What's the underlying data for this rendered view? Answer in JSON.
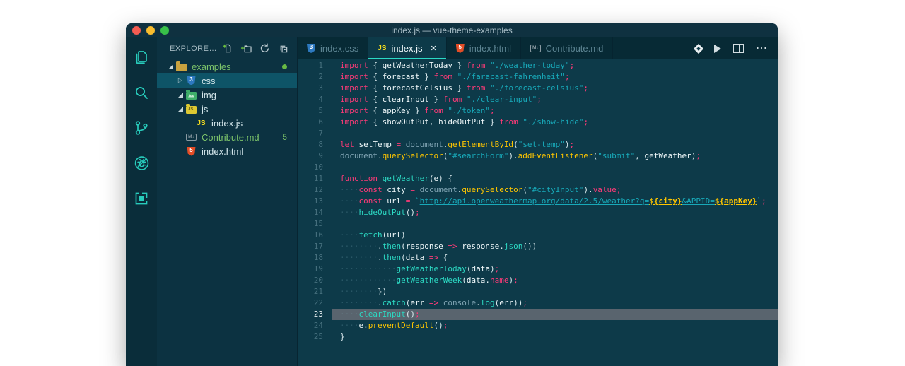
{
  "window": {
    "title": "index.js — vue-theme-examples"
  },
  "colors": {
    "accent_teal": "#2bd9c5",
    "keyword_pink": "#ff3a78",
    "method_yellow": "#ffc600",
    "string_teal": "#18a9b9",
    "green_modified": "#7cc36a",
    "editor_bg": "#0d3a49",
    "sidebar_bg": "#0c3241",
    "activitybar_bg": "#0a2d3a",
    "tabbar_bg": "#072a35",
    "selected_row": "#0e5467",
    "line_highlight": "#59646e",
    "traffic_red": "#f45c52",
    "traffic_yellow": "#f9bd2e",
    "traffic_green": "#38c149"
  },
  "activity_bar": {
    "items": [
      {
        "name": "explorer",
        "icon": "files-icon"
      },
      {
        "name": "search",
        "icon": "search-icon"
      },
      {
        "name": "source-control",
        "icon": "git-branch-icon"
      },
      {
        "name": "debug",
        "icon": "debug-disabled-icon"
      },
      {
        "name": "extensions",
        "icon": "extensions-icon"
      }
    ]
  },
  "sidebar": {
    "header": {
      "title": "EXPLORE…",
      "actions": [
        "new-file",
        "new-folder",
        "refresh",
        "collapse-all"
      ]
    },
    "tree": [
      {
        "label": "examples",
        "indent": 0,
        "twisty": "expanded",
        "icon": "folder-examples",
        "green": true,
        "dot": true
      },
      {
        "label": "css",
        "indent": 1,
        "twisty": "collapsed",
        "icon": "folder-css",
        "selected": true
      },
      {
        "label": "img",
        "indent": 1,
        "twisty": "expanded",
        "icon": "folder-img"
      },
      {
        "label": "js",
        "indent": 1,
        "twisty": "expanded",
        "icon": "folder-js"
      },
      {
        "label": "index.js",
        "indent": 2,
        "twisty": "none",
        "icon": "file-js"
      },
      {
        "label": "Contribute.md",
        "indent": 1,
        "twisty": "none",
        "icon": "file-md",
        "green": true,
        "badge": "5"
      },
      {
        "label": "index.html",
        "indent": 1,
        "twisty": "none",
        "icon": "file-html"
      }
    ]
  },
  "editor": {
    "tabs": [
      {
        "label": "index.css",
        "icon": "css",
        "active": false
      },
      {
        "label": "index.js",
        "icon": "js",
        "active": true,
        "close_glyph": "✕"
      },
      {
        "label": "index.html",
        "icon": "html",
        "active": false
      },
      {
        "label": "Contribute.md",
        "icon": "md",
        "active": false
      }
    ],
    "actions": [
      {
        "name": "formatter-diamond-icon"
      },
      {
        "name": "run-icon"
      },
      {
        "name": "split-editor-icon"
      },
      {
        "name": "more-actions-icon",
        "glyph": "⋯"
      }
    ],
    "active_line": 23,
    "lines": [
      {
        "n": 1,
        "tokens": [
          [
            "kw",
            "import"
          ],
          [
            "pl",
            " { "
          ],
          [
            "id",
            "getWeatherToday"
          ],
          [
            "pl",
            " } "
          ],
          [
            "kw",
            "from"
          ],
          [
            "pl",
            " "
          ],
          [
            "st",
            "\"./weather-today\""
          ],
          [
            "kw",
            ";"
          ]
        ]
      },
      {
        "n": 2,
        "tokens": [
          [
            "kw",
            "import"
          ],
          [
            "pl",
            " { "
          ],
          [
            "id",
            "forecast"
          ],
          [
            "pl",
            " } "
          ],
          [
            "kw",
            "from"
          ],
          [
            "pl",
            " "
          ],
          [
            "st",
            "\"./faracast-fahrenheit\""
          ],
          [
            "kw",
            ";"
          ]
        ]
      },
      {
        "n": 3,
        "tokens": [
          [
            "kw",
            "import"
          ],
          [
            "pl",
            " { "
          ],
          [
            "id",
            "forecastCelsius"
          ],
          [
            "pl",
            " } "
          ],
          [
            "kw",
            "from"
          ],
          [
            "pl",
            " "
          ],
          [
            "st",
            "\"./forecast-celsius\""
          ],
          [
            "kw",
            ";"
          ]
        ]
      },
      {
        "n": 4,
        "tokens": [
          [
            "kw",
            "import"
          ],
          [
            "pl",
            " { "
          ],
          [
            "id",
            "clearInput"
          ],
          [
            "pl",
            " } "
          ],
          [
            "kw",
            "from"
          ],
          [
            "pl",
            " "
          ],
          [
            "st",
            "\"./clear-input\""
          ],
          [
            "kw",
            ";"
          ]
        ]
      },
      {
        "n": 5,
        "tokens": [
          [
            "kw",
            "import"
          ],
          [
            "pl",
            " { "
          ],
          [
            "id",
            "appKey"
          ],
          [
            "pl",
            " } "
          ],
          [
            "kw",
            "from"
          ],
          [
            "pl",
            " "
          ],
          [
            "st",
            "\"./token\""
          ],
          [
            "kw",
            ";"
          ]
        ]
      },
      {
        "n": 6,
        "tokens": [
          [
            "kw",
            "import"
          ],
          [
            "pl",
            " { "
          ],
          [
            "id",
            "showOutPut"
          ],
          [
            "pl",
            ", "
          ],
          [
            "id",
            "hideOutPut"
          ],
          [
            "pl",
            " } "
          ],
          [
            "kw",
            "from"
          ],
          [
            "pl",
            " "
          ],
          [
            "st",
            "\"./show-hide\""
          ],
          [
            "kw",
            ";"
          ]
        ]
      },
      {
        "n": 7,
        "tokens": []
      },
      {
        "n": 8,
        "tokens": [
          [
            "kw",
            "let"
          ],
          [
            "pl",
            " "
          ],
          [
            "id",
            "setTemp"
          ],
          [
            "pl",
            " "
          ],
          [
            "kw",
            "="
          ],
          [
            "pl",
            " "
          ],
          [
            "ob",
            "document"
          ],
          [
            "pl",
            "."
          ],
          [
            "yf",
            "getElementById"
          ],
          [
            "pl",
            "("
          ],
          [
            "st",
            "\"set-temp\""
          ],
          [
            "pl",
            ")"
          ],
          [
            "kw",
            ";"
          ]
        ]
      },
      {
        "n": 9,
        "tokens": [
          [
            "ob",
            "document"
          ],
          [
            "pl",
            "."
          ],
          [
            "yf",
            "querySelector"
          ],
          [
            "pl",
            "("
          ],
          [
            "st",
            "\"#searchForm\""
          ],
          [
            "pl",
            ")."
          ],
          [
            "yf",
            "addEventListener"
          ],
          [
            "pl",
            "("
          ],
          [
            "st",
            "\"submit\""
          ],
          [
            "pl",
            ", "
          ],
          [
            "id",
            "getWeather"
          ],
          [
            "pl",
            ")"
          ],
          [
            "kw",
            ";"
          ]
        ]
      },
      {
        "n": 10,
        "tokens": []
      },
      {
        "n": 11,
        "tokens": [
          [
            "kw",
            "function"
          ],
          [
            "pl",
            " "
          ],
          [
            "fn",
            "getWeather"
          ],
          [
            "pl",
            "("
          ],
          [
            "id",
            "e"
          ],
          [
            "pl",
            ") {"
          ]
        ]
      },
      {
        "n": 12,
        "tokens": [
          [
            "ws",
            "    "
          ],
          [
            "kw",
            "const"
          ],
          [
            "pl",
            " "
          ],
          [
            "id",
            "city"
          ],
          [
            "pl",
            " "
          ],
          [
            "kw",
            "="
          ],
          [
            "pl",
            " "
          ],
          [
            "ob",
            "document"
          ],
          [
            "pl",
            "."
          ],
          [
            "yf",
            "querySelector"
          ],
          [
            "pl",
            "("
          ],
          [
            "st",
            "\"#cityInput\""
          ],
          [
            "pl",
            ")."
          ],
          [
            "kw",
            "value"
          ],
          [
            "kw",
            ";"
          ]
        ]
      },
      {
        "n": 13,
        "tokens": [
          [
            "ws",
            "    "
          ],
          [
            "kw",
            "const"
          ],
          [
            "pl",
            " "
          ],
          [
            "id",
            "url"
          ],
          [
            "pl",
            " "
          ],
          [
            "kw",
            "="
          ],
          [
            "pl",
            " "
          ],
          [
            "st",
            "`"
          ],
          [
            "stu",
            "http://api.openweathermap.org/data/2.5/weather?q="
          ],
          [
            "tp",
            "${city}"
          ],
          [
            "stu",
            "&APPID="
          ],
          [
            "tp",
            "${appKey}"
          ],
          [
            "st",
            "`"
          ],
          [
            "kw",
            ";"
          ]
        ]
      },
      {
        "n": 14,
        "tokens": [
          [
            "ws",
            "    "
          ],
          [
            "fn",
            "hideOutPut"
          ],
          [
            "pl",
            "()"
          ],
          [
            "kw",
            ";"
          ]
        ]
      },
      {
        "n": 15,
        "tokens": []
      },
      {
        "n": 16,
        "tokens": [
          [
            "ws",
            "    "
          ],
          [
            "fn",
            "fetch"
          ],
          [
            "pl",
            "("
          ],
          [
            "id",
            "url"
          ],
          [
            "pl",
            ")"
          ]
        ]
      },
      {
        "n": 17,
        "tokens": [
          [
            "ws",
            "        "
          ],
          [
            "pl",
            "."
          ],
          [
            "fn",
            "then"
          ],
          [
            "pl",
            "("
          ],
          [
            "id",
            "response"
          ],
          [
            "pl",
            " "
          ],
          [
            "kw",
            "=>"
          ],
          [
            "pl",
            " "
          ],
          [
            "id",
            "response"
          ],
          [
            "pl",
            "."
          ],
          [
            "fn",
            "json"
          ],
          [
            "pl",
            "())"
          ]
        ]
      },
      {
        "n": 18,
        "tokens": [
          [
            "ws",
            "        "
          ],
          [
            "pl",
            "."
          ],
          [
            "fn",
            "then"
          ],
          [
            "pl",
            "("
          ],
          [
            "id",
            "data"
          ],
          [
            "pl",
            " "
          ],
          [
            "kw",
            "=>"
          ],
          [
            "pl",
            " {"
          ]
        ]
      },
      {
        "n": 19,
        "tokens": [
          [
            "ws",
            "            "
          ],
          [
            "fn",
            "getWeatherToday"
          ],
          [
            "pl",
            "("
          ],
          [
            "id",
            "data"
          ],
          [
            "pl",
            ")"
          ],
          [
            "kw",
            ";"
          ]
        ]
      },
      {
        "n": 20,
        "tokens": [
          [
            "ws",
            "            "
          ],
          [
            "fn",
            "getWeatherWeek"
          ],
          [
            "pl",
            "("
          ],
          [
            "id",
            "data"
          ],
          [
            "pl",
            "."
          ],
          [
            "kw",
            "name"
          ],
          [
            "pl",
            ")"
          ],
          [
            "kw",
            ";"
          ]
        ]
      },
      {
        "n": 21,
        "tokens": [
          [
            "ws",
            "        "
          ],
          [
            "pl",
            "})"
          ]
        ]
      },
      {
        "n": 22,
        "tokens": [
          [
            "ws",
            "        "
          ],
          [
            "pl",
            "."
          ],
          [
            "fn",
            "catch"
          ],
          [
            "pl",
            "("
          ],
          [
            "id",
            "err"
          ],
          [
            "pl",
            " "
          ],
          [
            "kw",
            "=>"
          ],
          [
            "pl",
            " "
          ],
          [
            "ob",
            "console"
          ],
          [
            "pl",
            "."
          ],
          [
            "fn",
            "log"
          ],
          [
            "pl",
            "("
          ],
          [
            "id",
            "err"
          ],
          [
            "pl",
            "))"
          ],
          [
            "kw",
            ";"
          ]
        ]
      },
      {
        "n": 23,
        "tokens": [
          [
            "ws",
            "    "
          ],
          [
            "fn",
            "clearInput"
          ],
          [
            "pl",
            "()"
          ],
          [
            "kw",
            ";"
          ]
        ]
      },
      {
        "n": 24,
        "tokens": [
          [
            "ws",
            "    "
          ],
          [
            "id",
            "e"
          ],
          [
            "pl",
            "."
          ],
          [
            "yf",
            "preventDefault"
          ],
          [
            "pl",
            "()"
          ],
          [
            "kw",
            ";"
          ]
        ]
      },
      {
        "n": 25,
        "tokens": [
          [
            "pl",
            "}"
          ]
        ]
      }
    ]
  }
}
